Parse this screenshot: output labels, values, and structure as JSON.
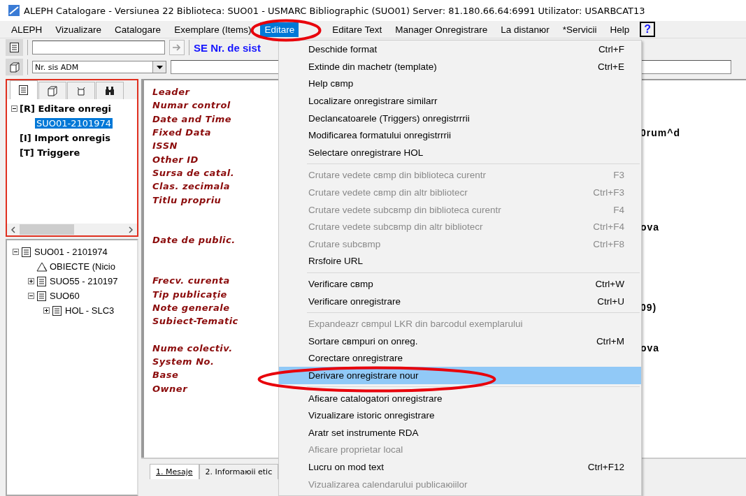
{
  "window": {
    "title": "ALEPH Catalogare - Versiunea 22  Biblioteca:  SUO01 - USMARC Bibliographic (SUO01)  Server:  81.180.66.64:6991  Utilizator:  USARBCAT13"
  },
  "menubar": {
    "items": [
      {
        "label": "ALEPH",
        "selected": false
      },
      {
        "label": "Vizualizare",
        "selected": false
      },
      {
        "label": "Catalogare",
        "selected": false
      },
      {
        "label": "Exemplare (Items)",
        "selected": false
      },
      {
        "label": "Editare",
        "selected": true
      },
      {
        "label": "Editare Text",
        "selected": false
      },
      {
        "label": "Manager Onregistrare",
        "selected": false
      },
      {
        "label": "La distanюr",
        "selected": false
      },
      {
        "label": "*Servicii",
        "selected": false
      },
      {
        "label": "Help",
        "selected": false
      }
    ],
    "help_button": "?"
  },
  "toolbar": {
    "search_value_label": "SE Nr. de sist",
    "index_select": "Nr. sis ADM"
  },
  "task_pane": {
    "tabs": [
      {
        "kind": "record",
        "selected": true
      },
      {
        "kind": "box",
        "selected": false
      },
      {
        "kind": "tag",
        "selected": false
      },
      {
        "kind": "binoculars",
        "selected": false
      }
    ],
    "tree": [
      {
        "label": "[R] Editare onregi",
        "expanded": true,
        "selected": false,
        "children": [
          {
            "label": "SUO01-2101974",
            "selected": true
          }
        ]
      },
      {
        "label": "[I] Import onregis",
        "selected": false
      },
      {
        "label": "[T] Triggere",
        "selected": false
      }
    ]
  },
  "record_tree": [
    {
      "label": "SUO01 - 2101974",
      "kind": "record",
      "expanded": true,
      "children": [
        {
          "label": "OBIECTE (Nicio",
          "kind": "objects"
        },
        {
          "label": "SUO55 - 210197",
          "kind": "record",
          "expanded": false
        },
        {
          "label": "SUO60",
          "kind": "record",
          "expanded": true,
          "children": [
            {
              "label": "HOL - SLC3",
              "kind": "record",
              "expanded": false
            }
          ]
        }
      ]
    }
  ],
  "record_fields": [
    {
      "kind": "field",
      "label": "Leader"
    },
    {
      "kind": "field",
      "label": "Numar control"
    },
    {
      "kind": "field",
      "label": "Date and Time"
    },
    {
      "kind": "field",
      "label": "Fixed Data",
      "value": "0rum^d"
    },
    {
      "kind": "field",
      "label": "ISSN"
    },
    {
      "kind": "field",
      "label": "Other ID"
    },
    {
      "kind": "field",
      "label": "Sursa de catal."
    },
    {
      "kind": "field",
      "label": "Clas. zecimala"
    },
    {
      "kind": "field",
      "label": "Titlu propriu"
    },
    {
      "kind": "spacer"
    },
    {
      "kind": "continuation",
      "value": "ova"
    },
    {
      "kind": "field",
      "label": "Date de public."
    },
    {
      "kind": "spacer"
    },
    {
      "kind": "spacer"
    },
    {
      "kind": "field",
      "label": "Frecv. curenta"
    },
    {
      "kind": "field",
      "label": "Tip publicaţie"
    },
    {
      "kind": "field",
      "label": "Note generale",
      "value": "09)"
    },
    {
      "kind": "field",
      "label": "Subiect-Tematic"
    },
    {
      "kind": "spacer"
    },
    {
      "kind": "field",
      "label": "Nume colectiv.",
      "value": "ova"
    },
    {
      "kind": "field",
      "label": "System No."
    },
    {
      "kind": "field",
      "label": "Base"
    },
    {
      "kind": "field",
      "label": "Owner"
    }
  ],
  "bottom_tabs": [
    {
      "label": "1. Mesaje",
      "selected": true
    },
    {
      "label": "2. Informaюii etic",
      "selected": false
    }
  ],
  "editare_menu": [
    {
      "kind": "item",
      "label": "Deschide format",
      "shortcut": "Ctrl+F",
      "disabled": false,
      "selected": false
    },
    {
      "kind": "item",
      "label": "Extinde din machetr (template)",
      "shortcut": "Ctrl+E",
      "disabled": false,
      "selected": false
    },
    {
      "kind": "item",
      "label": "Help cвmp",
      "disabled": false,
      "selected": false
    },
    {
      "kind": "item",
      "label": "Localizare onregistrare similarr",
      "disabled": false,
      "selected": false
    },
    {
      "kind": "item",
      "label": "Declanєatoarele (Triggers) onregistrrrii",
      "disabled": false,
      "selected": false
    },
    {
      "kind": "item",
      "label": "Modificarea formatului onregistrrrii",
      "disabled": false,
      "selected": false
    },
    {
      "kind": "item",
      "label": "Selectare onregistrare HOL",
      "disabled": false,
      "selected": false
    },
    {
      "kind": "separator"
    },
    {
      "kind": "item",
      "label": "Crutare vedete cвmp din biblioteca curentr",
      "shortcut": "F3",
      "disabled": true,
      "selected": false
    },
    {
      "kind": "item",
      "label": "Crutare vedete cвmp din altr bibliotecr",
      "shortcut": "Ctrl+F3",
      "disabled": true,
      "selected": false
    },
    {
      "kind": "item",
      "label": "Crutare vedete subcвmp din biblioteca curentr",
      "shortcut": "F4",
      "disabled": true,
      "selected": false
    },
    {
      "kind": "item",
      "label": "Crutare vedete subcвmp din altr bibliotecr",
      "shortcut": "Ctrl+F4",
      "disabled": true,
      "selected": false
    },
    {
      "kind": "item",
      "label": "Crutare subcвmp",
      "shortcut": "Ctrl+F8",
      "disabled": true,
      "selected": false
    },
    {
      "kind": "item",
      "label": "Rrsfoire URL",
      "disabled": false,
      "selected": false
    },
    {
      "kind": "separator"
    },
    {
      "kind": "item",
      "label": "Verificare cвmp",
      "shortcut": "Ctrl+W",
      "disabled": false,
      "selected": false
    },
    {
      "kind": "item",
      "label": "Verificare onregistrare",
      "shortcut": "Ctrl+U",
      "disabled": false,
      "selected": false
    },
    {
      "kind": "separator"
    },
    {
      "kind": "item",
      "label": "Expandeazr cвmpul LKR din barcodul exemplarului",
      "disabled": true,
      "selected": false
    },
    {
      "kind": "item",
      "label": "Sortare cвmpuri on onreg.",
      "shortcut": "Ctrl+M",
      "disabled": false,
      "selected": false
    },
    {
      "kind": "item",
      "label": "Corectare onregistrare",
      "disabled": false,
      "selected": false
    },
    {
      "kind": "item",
      "label": "Derivare onregistrare nour",
      "disabled": false,
      "selected": true
    },
    {
      "kind": "separator"
    },
    {
      "kind": "item",
      "label": "Afiєare catalogatori onregistrare",
      "disabled": false,
      "selected": false
    },
    {
      "kind": "item",
      "label": "Vizualizare istoric onregistrare",
      "disabled": false,
      "selected": false
    },
    {
      "kind": "item",
      "label": "Aratr set instrumente RDA",
      "disabled": false,
      "selected": false
    },
    {
      "kind": "item",
      "label": "Afiєare proprietar local",
      "disabled": true,
      "selected": false
    },
    {
      "kind": "item",
      "label": "Lucru on mod text",
      "shortcut": "Ctrl+F12",
      "disabled": false,
      "selected": false
    },
    {
      "kind": "item",
      "label": "Vizualizarea calendarului publicaюiilor",
      "disabled": true,
      "selected": false
    }
  ],
  "callouts": [
    {
      "kind": "ellipse"
    },
    {
      "kind": "ellipse"
    }
  ]
}
